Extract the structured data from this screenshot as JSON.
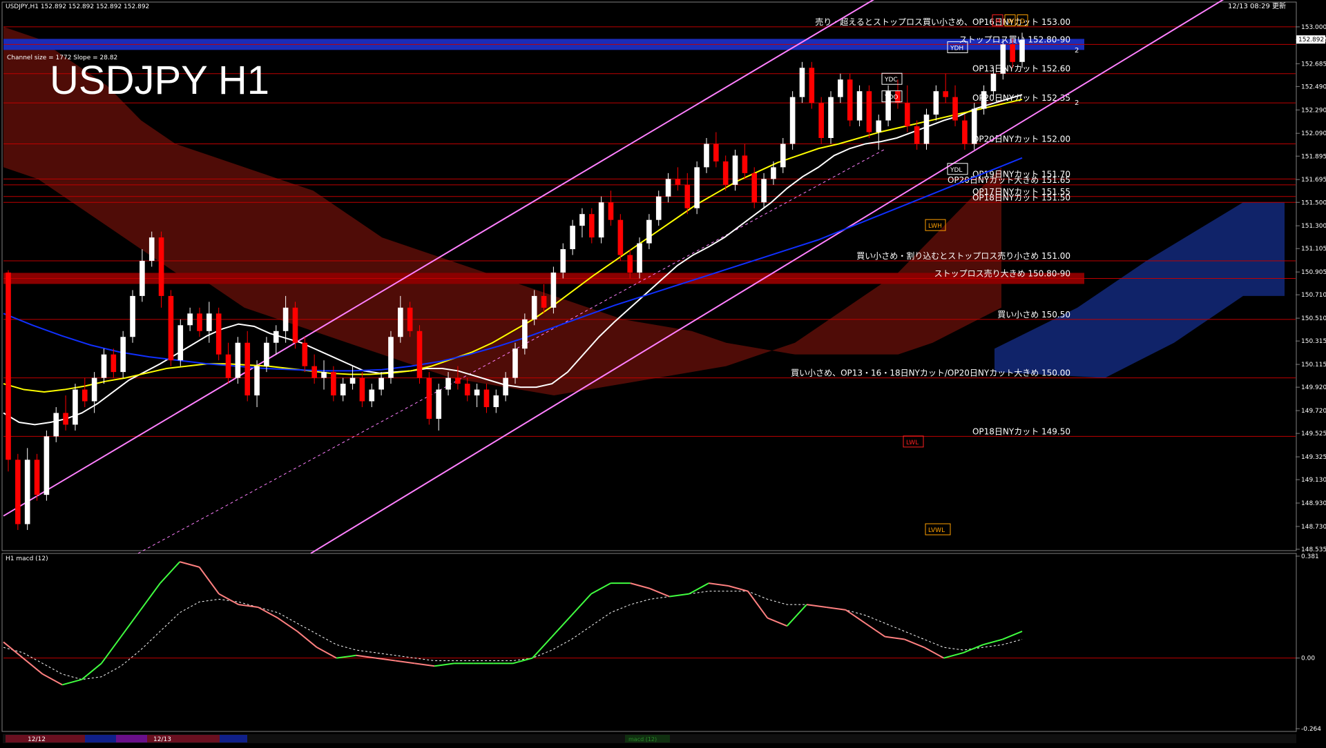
{
  "header": {
    "info": "USDJPY,H1  152.892 152.892 152.892 152.892",
    "timestamp": "12/13 08:29 更新"
  },
  "title": "USDJPY H1",
  "channel_info": "Channel size = 1772 Slope = 28.82",
  "macd_label": "H1  macd (12)",
  "bottom_tabs": {
    "d1": "12/12",
    "d2": "12/13",
    "legend": "macd (12)"
  },
  "colors": {
    "background": "#000000",
    "bull_candle": "#ffffff",
    "bear_candle": "#ff0000",
    "cloud_red": "#b01a10",
    "cloud_blue": "#1d3fc0",
    "channel": "#ff80ff",
    "ma_white": "#ffffff",
    "ma_yellow": "#ffff00",
    "ma_blue": "#1030ff",
    "chikou_green": "#00c000",
    "level_line": "#c00000",
    "macd_up": "#40ff40",
    "macd_down": "#ff8080"
  },
  "chart_data": [
    {
      "type": "candlestick",
      "title": "USDJPY H1",
      "ylim": [
        148.535,
        153.2
      ],
      "y_ticks": [
        "153.000",
        "152.892",
        "152.685",
        "152.490",
        "152.290",
        "152.090",
        "151.895",
        "151.695",
        "151.500",
        "151.300",
        "151.105",
        "150.905",
        "150.710",
        "150.510",
        "150.315",
        "150.115",
        "149.920",
        "149.720",
        "149.525",
        "149.325",
        "149.130",
        "148.930",
        "148.730",
        "148.535"
      ],
      "current_price": 152.892,
      "ohlc": [
        [
          150.9,
          150.92,
          149.2,
          149.3
        ],
        [
          149.3,
          149.35,
          148.7,
          148.75
        ],
        [
          148.75,
          149.4,
          148.7,
          149.3
        ],
        [
          149.3,
          149.35,
          148.95,
          149.0
        ],
        [
          149.0,
          149.55,
          148.95,
          149.5
        ],
        [
          149.5,
          149.75,
          149.45,
          149.7
        ],
        [
          149.7,
          149.85,
          149.55,
          149.6
        ],
        [
          149.6,
          149.95,
          149.55,
          149.9
        ],
        [
          149.9,
          150.0,
          149.75,
          149.8
        ],
        [
          149.8,
          150.05,
          149.7,
          150.0
        ],
        [
          150.0,
          150.25,
          149.95,
          150.2
        ],
        [
          150.2,
          150.25,
          150.0,
          150.05
        ],
        [
          150.05,
          150.4,
          150.0,
          150.35
        ],
        [
          150.35,
          150.75,
          150.3,
          150.7
        ],
        [
          150.7,
          151.1,
          150.65,
          151.0
        ],
        [
          151.0,
          151.25,
          150.95,
          151.2
        ],
        [
          151.2,
          151.25,
          150.6,
          150.7
        ],
        [
          150.7,
          150.75,
          150.1,
          150.15
        ],
        [
          150.15,
          150.5,
          150.1,
          150.45
        ],
        [
          150.45,
          150.6,
          150.4,
          150.55
        ],
        [
          150.55,
          150.6,
          150.35,
          150.4
        ],
        [
          150.4,
          150.65,
          150.3,
          150.55
        ],
        [
          150.55,
          150.6,
          150.15,
          150.2
        ],
        [
          150.2,
          150.3,
          149.95,
          150.0
        ],
        [
          150.0,
          150.35,
          149.95,
          150.3
        ],
        [
          150.3,
          150.4,
          149.8,
          149.85
        ],
        [
          149.85,
          150.15,
          149.75,
          150.1
        ],
        [
          150.1,
          150.35,
          150.05,
          150.3
        ],
        [
          150.3,
          150.45,
          150.2,
          150.4
        ],
        [
          150.4,
          150.7,
          150.3,
          150.6
        ],
        [
          150.6,
          150.65,
          150.25,
          150.3
        ],
        [
          150.3,
          150.35,
          150.05,
          150.1
        ],
        [
          150.1,
          150.2,
          149.95,
          150.0
        ],
        [
          150.0,
          150.15,
          149.9,
          150.05
        ],
        [
          150.05,
          150.1,
          149.8,
          149.85
        ],
        [
          149.85,
          150.0,
          149.8,
          149.95
        ],
        [
          149.95,
          150.1,
          149.9,
          150.0
        ],
        [
          150.0,
          150.05,
          149.75,
          149.8
        ],
        [
          149.8,
          149.95,
          149.75,
          149.9
        ],
        [
          149.9,
          150.05,
          149.85,
          150.0
        ],
        [
          150.0,
          150.4,
          149.95,
          150.35
        ],
        [
          150.35,
          150.7,
          150.3,
          150.6
        ],
        [
          150.6,
          150.65,
          150.35,
          150.4
        ],
        [
          150.4,
          150.45,
          149.95,
          150.0
        ],
        [
          150.0,
          150.05,
          149.6,
          149.65
        ],
        [
          149.65,
          149.95,
          149.55,
          149.9
        ],
        [
          149.9,
          150.05,
          149.85,
          150.0
        ],
        [
          150.0,
          150.1,
          149.9,
          149.95
        ],
        [
          149.95,
          150.0,
          149.8,
          149.85
        ],
        [
          149.85,
          149.95,
          149.75,
          149.9
        ],
        [
          149.9,
          149.95,
          149.7,
          149.75
        ],
        [
          149.75,
          149.9,
          149.7,
          149.85
        ],
        [
          149.85,
          150.05,
          149.8,
          150.0
        ],
        [
          150.0,
          150.3,
          149.95,
          150.25
        ],
        [
          150.25,
          150.55,
          150.2,
          150.5
        ],
        [
          150.5,
          150.75,
          150.45,
          150.7
        ],
        [
          150.7,
          150.8,
          150.55,
          150.6
        ],
        [
          150.6,
          150.95,
          150.55,
          150.9
        ],
        [
          150.9,
          151.15,
          150.85,
          151.1
        ],
        [
          151.1,
          151.35,
          151.05,
          151.3
        ],
        [
          151.3,
          151.45,
          151.2,
          151.4
        ],
        [
          151.4,
          151.45,
          151.15,
          151.2
        ],
        [
          151.2,
          151.55,
          151.15,
          151.5
        ],
        [
          151.5,
          151.6,
          151.3,
          151.35
        ],
        [
          151.35,
          151.4,
          151.0,
          151.05
        ],
        [
          151.05,
          151.1,
          150.85,
          150.9
        ],
        [
          150.9,
          151.2,
          150.85,
          151.15
        ],
        [
          151.15,
          151.4,
          151.1,
          151.35
        ],
        [
          151.35,
          151.6,
          151.3,
          151.55
        ],
        [
          151.55,
          151.75,
          151.5,
          151.7
        ],
        [
          151.7,
          151.8,
          151.6,
          151.65
        ],
        [
          151.65,
          151.75,
          151.4,
          151.45
        ],
        [
          151.45,
          151.85,
          151.4,
          151.8
        ],
        [
          151.8,
          152.05,
          151.75,
          152.0
        ],
        [
          152.0,
          152.1,
          151.8,
          151.85
        ],
        [
          151.85,
          151.9,
          151.6,
          151.65
        ],
        [
          151.65,
          151.95,
          151.6,
          151.9
        ],
        [
          151.9,
          152.0,
          151.7,
          151.75
        ],
        [
          151.75,
          151.8,
          151.45,
          151.5
        ],
        [
          151.5,
          151.75,
          151.45,
          151.7
        ],
        [
          151.7,
          151.85,
          151.65,
          151.8
        ],
        [
          151.8,
          152.05,
          151.75,
          152.0
        ],
        [
          152.0,
          152.45,
          151.95,
          152.4
        ],
        [
          152.4,
          152.7,
          152.35,
          152.65
        ],
        [
          152.65,
          152.7,
          152.3,
          152.35
        ],
        [
          152.35,
          152.4,
          152.0,
          152.05
        ],
        [
          152.05,
          152.45,
          152.0,
          152.4
        ],
        [
          152.4,
          152.6,
          152.35,
          152.55
        ],
        [
          152.55,
          152.6,
          152.15,
          152.2
        ],
        [
          152.2,
          152.5,
          152.15,
          152.45
        ],
        [
          152.45,
          152.5,
          152.05,
          152.1
        ],
        [
          152.1,
          152.25,
          151.95,
          152.2
        ],
        [
          152.2,
          152.5,
          152.15,
          152.45
        ],
        [
          152.45,
          152.55,
          152.3,
          152.35
        ],
        [
          152.35,
          152.5,
          152.1,
          152.15
        ],
        [
          152.15,
          152.2,
          151.95,
          152.0
        ],
        [
          152.0,
          152.3,
          151.95,
          152.25
        ],
        [
          152.25,
          152.5,
          152.2,
          152.45
        ],
        [
          152.45,
          152.6,
          152.35,
          152.4
        ],
        [
          152.4,
          152.5,
          152.15,
          152.2
        ],
        [
          152.2,
          152.25,
          151.95,
          152.0
        ],
        [
          152.0,
          152.35,
          151.95,
          152.3
        ],
        [
          152.3,
          152.5,
          152.25,
          152.45
        ],
        [
          152.45,
          152.65,
          152.4,
          152.6
        ],
        [
          152.6,
          152.9,
          152.55,
          152.85
        ],
        [
          152.85,
          152.9,
          152.65,
          152.7
        ],
        [
          152.7,
          152.95,
          152.65,
          152.89
        ]
      ],
      "moving_averages": [
        {
          "color": "#ffffff",
          "values": [
            149.7,
            149.62,
            149.6,
            149.62,
            149.65,
            149.7,
            149.78,
            149.88,
            149.98,
            150.05,
            150.12,
            150.2,
            150.28,
            150.36,
            150.42,
            150.46,
            150.44,
            150.38,
            150.34,
            150.3,
            150.24,
            150.18,
            150.12,
            150.06,
            150.04,
            150.05,
            150.06,
            150.08,
            150.08,
            150.06,
            150.02,
            149.98,
            149.94,
            149.92,
            149.92,
            149.95,
            150.05,
            150.2,
            150.35,
            150.48,
            150.6,
            150.72,
            150.84,
            150.96,
            151.05,
            151.12,
            151.2,
            151.3,
            151.4,
            151.5,
            151.62,
            151.72,
            151.8,
            151.9,
            151.96,
            152.0,
            152.02,
            152.05,
            152.1,
            152.15,
            152.2,
            152.24,
            152.3,
            152.34,
            152.38,
            152.42
          ]
        },
        {
          "color": "#ffff00",
          "values": [
            149.95,
            149.9,
            149.88,
            149.9,
            149.93,
            149.97,
            150.0,
            150.04,
            150.08,
            150.1,
            150.12,
            150.12,
            150.11,
            150.1,
            150.08,
            150.06,
            150.04,
            150.03,
            150.03,
            150.04,
            150.06,
            150.1,
            150.16,
            150.22,
            150.3,
            150.4,
            150.5,
            150.62,
            150.75,
            150.88,
            151.0,
            151.12,
            151.24,
            151.36,
            151.48,
            151.58,
            151.68,
            151.76,
            151.84,
            151.9,
            151.96,
            152.0,
            152.05,
            152.1,
            152.14,
            152.18,
            152.22,
            152.26,
            152.3,
            152.34,
            152.38
          ]
        },
        {
          "color": "#1030ff",
          "values": [
            150.55,
            150.45,
            150.36,
            150.28,
            150.22,
            150.18,
            150.15,
            150.12,
            150.1,
            150.08,
            150.07,
            150.06,
            150.06,
            150.07,
            150.1,
            150.14,
            150.2,
            150.27,
            150.35,
            150.44,
            150.53,
            150.62,
            150.7,
            150.78,
            150.86,
            150.94,
            151.02,
            151.1,
            151.18,
            151.28,
            151.38,
            151.48,
            151.58,
            151.68,
            151.78,
            151.88
          ]
        }
      ],
      "levels": [
        {
          "price": 153.0,
          "label": "売り・超えるとストップロス買い小さめ、OP16日NYカット 153.00"
        },
        {
          "price": 152.85,
          "label": "ストップロス買い 152.80-90",
          "band": true,
          "band_color": "#1a2cb8"
        },
        {
          "price": 152.6,
          "label": "OP13日NYカット 152.60"
        },
        {
          "price": 152.35,
          "label": "OP20日NYカット 152.35"
        },
        {
          "price": 152.0,
          "label": "OP20日NYカット 152.00"
        },
        {
          "price": 151.7,
          "label": "OP19日NYカット 151.70"
        },
        {
          "price": 151.65,
          "label": "OP20日NYカット大きめ 151.65"
        },
        {
          "price": 151.55,
          "label": "OP17日NYカット 151.55"
        },
        {
          "price": 151.5,
          "label": "OP18日NYカット 151.50"
        },
        {
          "price": 151.0,
          "label": "買い小さめ・割り込むとストップロス売り小さめ 151.00"
        },
        {
          "price": 150.85,
          "label": "ストップロス売り大きめ 150.80-90",
          "band": true,
          "band_color": "#8a0000"
        },
        {
          "price": 150.5,
          "label": "買い小さめ 150.50"
        },
        {
          "price": 150.0,
          "label": "買い小さめ、OP13・16・18日NYカット/OP20日NYカット大きめ 150.00"
        },
        {
          "price": 149.5,
          "label": "OP18日NYカット 149.50"
        }
      ],
      "markers": [
        "YDH",
        "YDC",
        "YDO",
        "YDL",
        "LWH",
        "LWL",
        "LVWL",
        "M",
        "W",
        "D"
      ],
      "fibo_marks": [
        "2",
        "2"
      ]
    },
    {
      "type": "line",
      "title": "H1  macd (12)",
      "ylim": [
        -0.264,
        0.381
      ],
      "y_ticks": [
        "0.381",
        "0.00",
        "-0.264"
      ],
      "series": [
        {
          "name": "macd",
          "values": [
            0.06,
            0.0,
            -0.06,
            -0.1,
            -0.08,
            -0.02,
            0.08,
            0.18,
            0.28,
            0.36,
            0.34,
            0.24,
            0.2,
            0.19,
            0.15,
            0.1,
            0.04,
            0.0,
            0.01,
            0.0,
            -0.01,
            -0.02,
            -0.03,
            -0.02,
            -0.02,
            -0.02,
            -0.02,
            0.0,
            0.08,
            0.16,
            0.24,
            0.28,
            0.28,
            0.26,
            0.23,
            0.24,
            0.28,
            0.27,
            0.25,
            0.15,
            0.12,
            0.2,
            0.19,
            0.18,
            0.13,
            0.08,
            0.07,
            0.04,
            0.0,
            0.02,
            0.05,
            0.07,
            0.1
          ]
        },
        {
          "name": "signal",
          "values": [
            0.04,
            0.02,
            -0.02,
            -0.06,
            -0.08,
            -0.07,
            -0.03,
            0.03,
            0.1,
            0.17,
            0.21,
            0.22,
            0.21,
            0.19,
            0.17,
            0.13,
            0.09,
            0.05,
            0.03,
            0.02,
            0.01,
            0.0,
            -0.01,
            -0.01,
            -0.01,
            -0.01,
            -0.01,
            0.0,
            0.03,
            0.07,
            0.12,
            0.17,
            0.2,
            0.22,
            0.23,
            0.24,
            0.25,
            0.25,
            0.25,
            0.22,
            0.2,
            0.2,
            0.19,
            0.18,
            0.16,
            0.13,
            0.1,
            0.07,
            0.04,
            0.03,
            0.04,
            0.05,
            0.07
          ]
        }
      ],
      "zero_line": 0.0
    }
  ]
}
